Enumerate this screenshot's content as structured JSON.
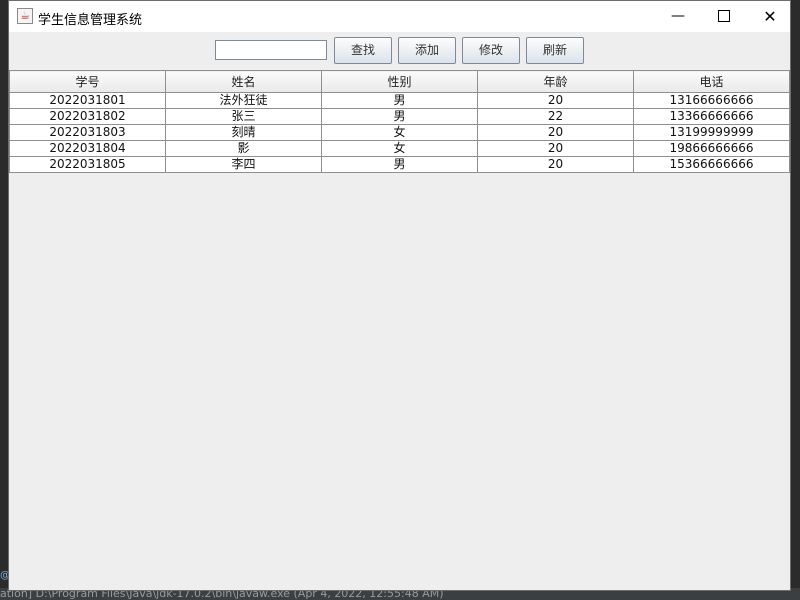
{
  "window": {
    "title": "学生信息管理系统",
    "icon": "java-cup-icon",
    "controls": {
      "minimize": "—",
      "close": "✕"
    }
  },
  "toolbar": {
    "search_value": "",
    "search_label": "查找",
    "add_label": "添加",
    "edit_label": "修改",
    "refresh_label": "刷新"
  },
  "table": {
    "columns": [
      "学号",
      "姓名",
      "性别",
      "年龄",
      "电话"
    ],
    "rows": [
      [
        "2022031801",
        "法外狂徒",
        "男",
        "20",
        "13166666666"
      ],
      [
        "2022031802",
        "张三",
        "男",
        "22",
        "13366666666"
      ],
      [
        "2022031803",
        "刻晴",
        "女",
        "20",
        "13199999999"
      ],
      [
        "2022031804",
        "影",
        "女",
        "20",
        "19866666666"
      ],
      [
        "2022031805",
        "李四",
        "男",
        "20",
        "15366666666"
      ]
    ]
  },
  "background": {
    "status_text": "ation] D:\\Program Files\\Java\\jdk-17.0.2\\bin\\javaw.exe  (Apr 4, 2022, 12:55:48 AM)"
  }
}
